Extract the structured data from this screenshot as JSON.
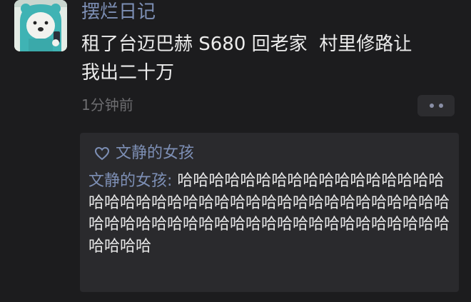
{
  "post": {
    "username": "摆烂日记",
    "content": "租了台迈巴赫 S680 回老家  村里修路让\n我出二十万",
    "timestamp": "1分钟前"
  },
  "likes": {
    "names": "文静的女孩"
  },
  "comments": [
    {
      "author": "文静的女孩",
      "separator": ": ",
      "text": "哈哈哈哈哈哈哈哈哈哈哈哈哈哈哈哈哈哈哈哈哈哈哈哈哈哈哈哈哈哈哈哈哈哈哈哈哈哈哈哈哈哈哈哈哈哈哈哈哈哈哈哈哈哈哈哈哈哈哈哈哈哈哈哈哈哈哈"
    }
  ],
  "colors": {
    "background": "#1c1c1e",
    "link_blue": "#7d8fb5",
    "panel": "#2a2a2d"
  }
}
